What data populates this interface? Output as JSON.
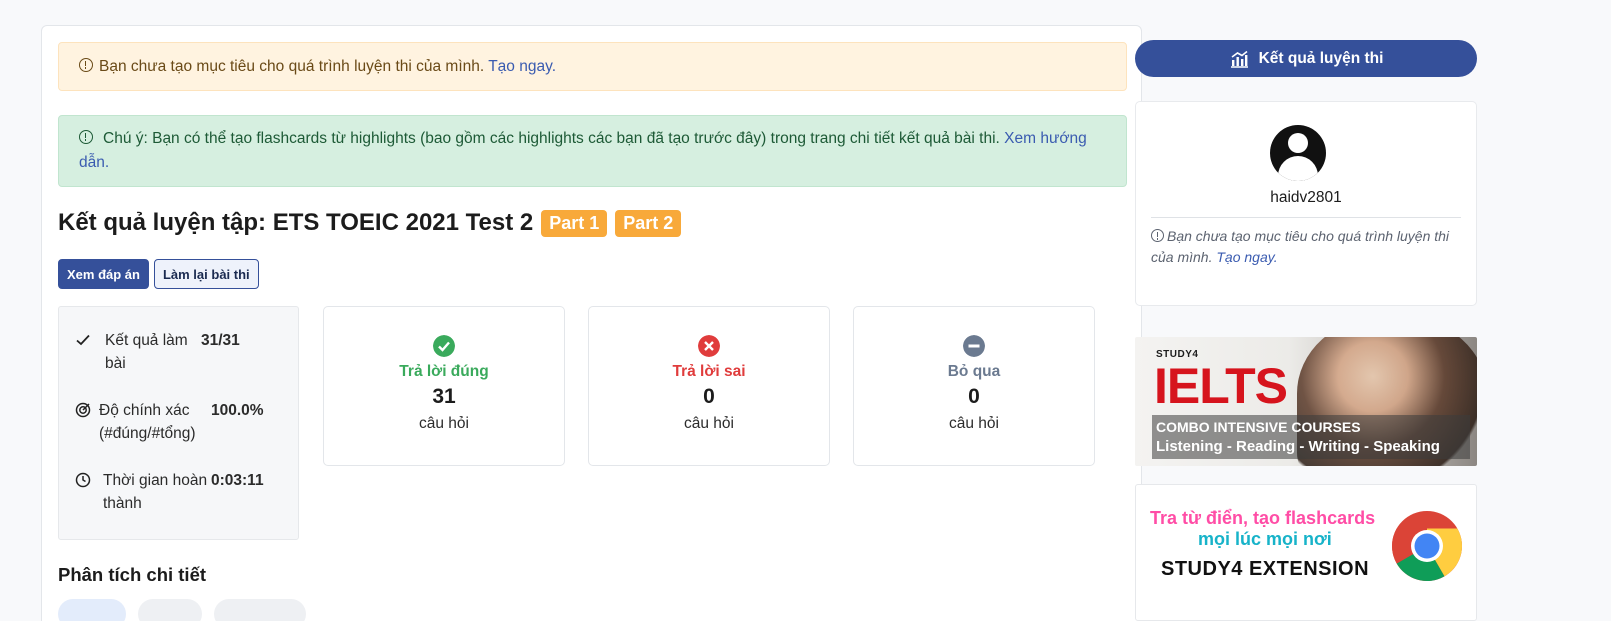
{
  "alerts": {
    "goal_text": "Bạn chưa tạo mục tiêu cho quá trình luyện thi của mình.",
    "goal_link": "Tạo ngay.",
    "note_text": "Chú ý: Bạn có thể tạo flashcards từ highlights (bao gồm các highlights các bạn đã tạo trước đây) trong trang chi tiết kết quả bài thi.",
    "note_link": "Xem hướng dẫn."
  },
  "title": {
    "text": "Kết quả luyện tập: ETS TOEIC 2021 Test 2",
    "badges": [
      "Part 1",
      "Part 2"
    ]
  },
  "buttons": {
    "view_answers": "Xem đáp án",
    "redo": "Làm lại bài thi"
  },
  "stats": [
    {
      "label": "Kết quả làm bài",
      "value": "31/31",
      "icon": "check-icon"
    },
    {
      "label": "Độ chính xác (#đúng/#tổng)",
      "value": "100.0%",
      "icon": "target-icon"
    },
    {
      "label": "Thời gian hoàn thành",
      "value": "0:03:11",
      "icon": "clock-icon"
    }
  ],
  "results": [
    {
      "label": "Trả lời đúng",
      "value": "31",
      "unit": "câu hỏi",
      "color": "#3aaa5c",
      "icon": "check-circle-icon"
    },
    {
      "label": "Trả lời sai",
      "value": "0",
      "unit": "câu hỏi",
      "color": "#e03c3c",
      "icon": "x-circle-icon"
    },
    {
      "label": "Bỏ qua",
      "value": "0",
      "unit": "câu hỏi",
      "color": "#6b7a90",
      "icon": "minus-circle-icon"
    }
  ],
  "section": {
    "title": "Phân tích chi tiết"
  },
  "sidebar": {
    "result_button": "Kết quả luyện thi",
    "username": "haidv2801",
    "note_text": "Bạn chưa tạo mục tiêu cho quá trình luyện thi của mình.",
    "note_link": "Tạo ngay."
  },
  "ielts_banner": {
    "brand": "STUDY4",
    "headline": "IELTS",
    "line1": "COMBO INTENSIVE COURSES",
    "line2": "Listening - Reading - Writing - Speaking"
  },
  "extension_banner": {
    "line1": "Tra từ điển, tạo flashcards",
    "line2": "mọi lúc mọi nơi",
    "line3": "STUDY4 EXTENSION"
  },
  "colors": {
    "primary": "#35509a",
    "badge": "#f8a93a"
  }
}
